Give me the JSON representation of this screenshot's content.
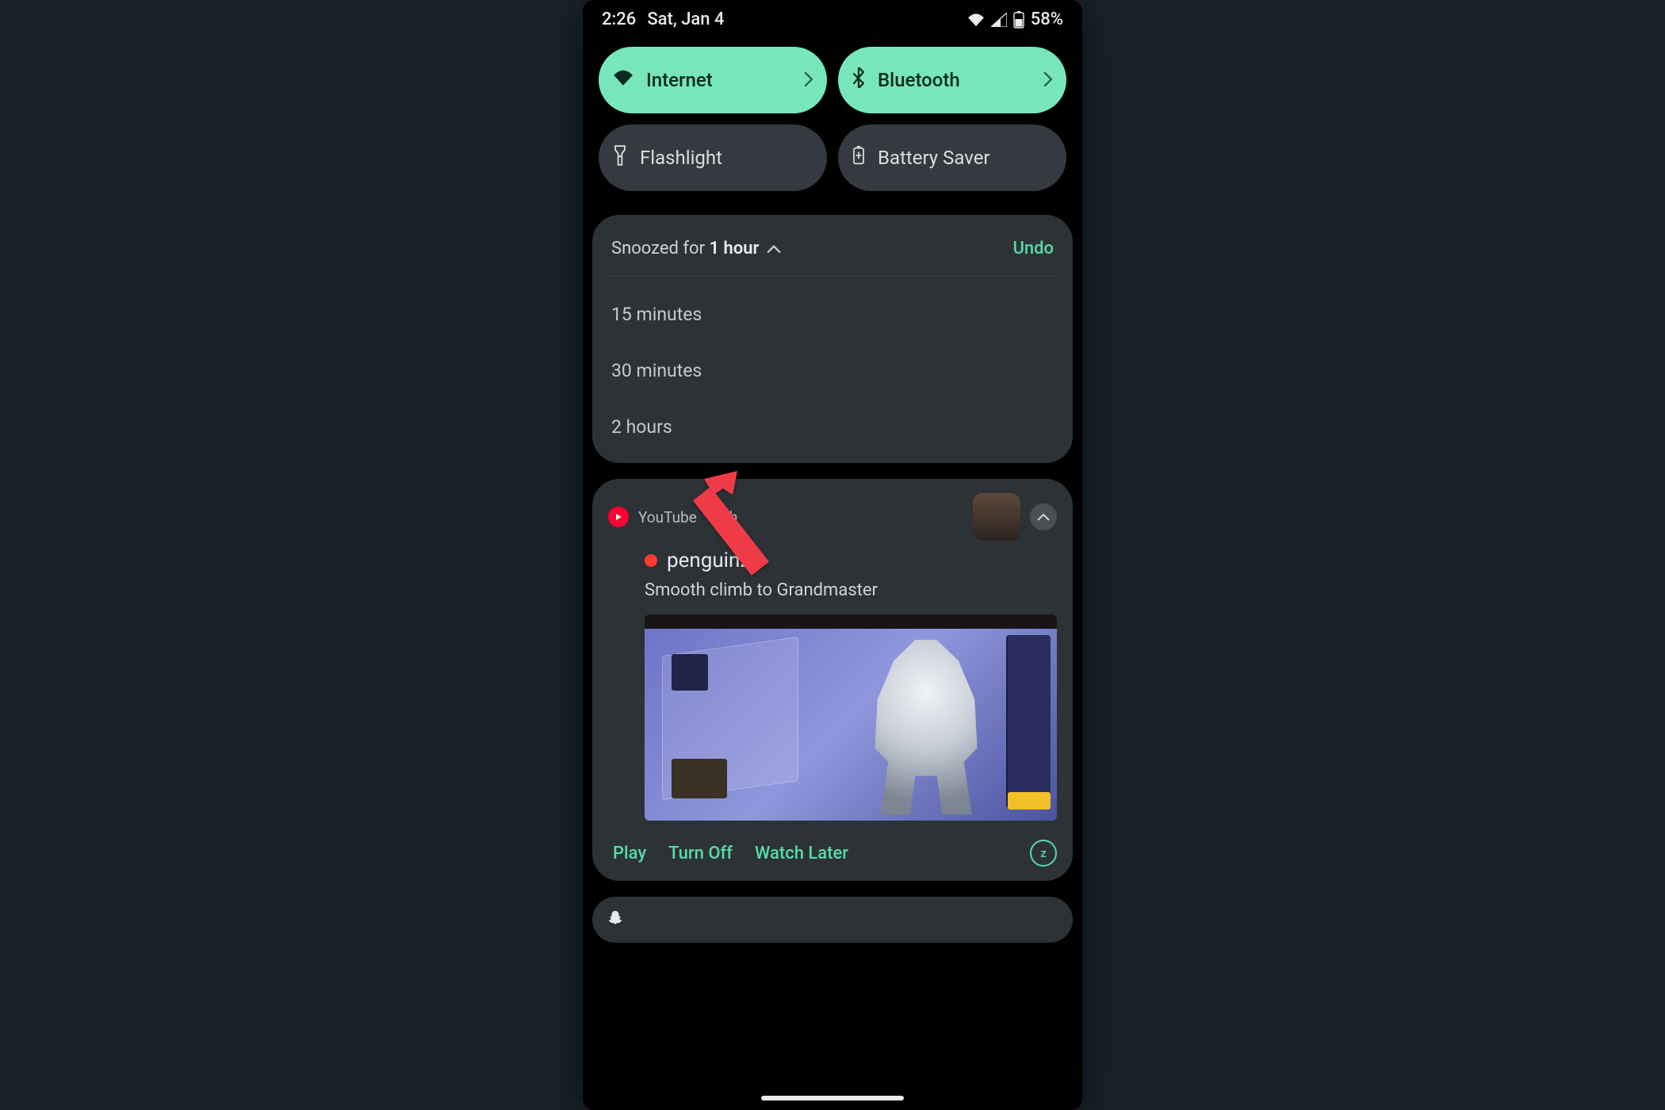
{
  "statusbar": {
    "time": "2:26",
    "date": "Sat, Jan 4",
    "battery_pct": "58%"
  },
  "tiles": {
    "internet": "Internet",
    "bluetooth": "Bluetooth",
    "flashlight": "Flashlight",
    "battery_saver": "Battery Saver"
  },
  "snooze": {
    "prefix": "Snoozed for ",
    "duration": "1 hour",
    "undo": "Undo",
    "options": [
      "15 minutes",
      "30 minutes",
      "2 hours"
    ]
  },
  "youtube": {
    "app": "YouTube",
    "sep": " • ",
    "age": "3h",
    "channel": "penguinz0",
    "title": "Smooth climb to Grandmaster",
    "actions": {
      "play": "Play",
      "turn_off": "Turn Off",
      "watch_later": "Watch Later"
    },
    "snooze_glyph": "z"
  },
  "colors": {
    "accent": "#58dba7",
    "tileActive": "#77e7bb",
    "card": "#2c3236"
  }
}
